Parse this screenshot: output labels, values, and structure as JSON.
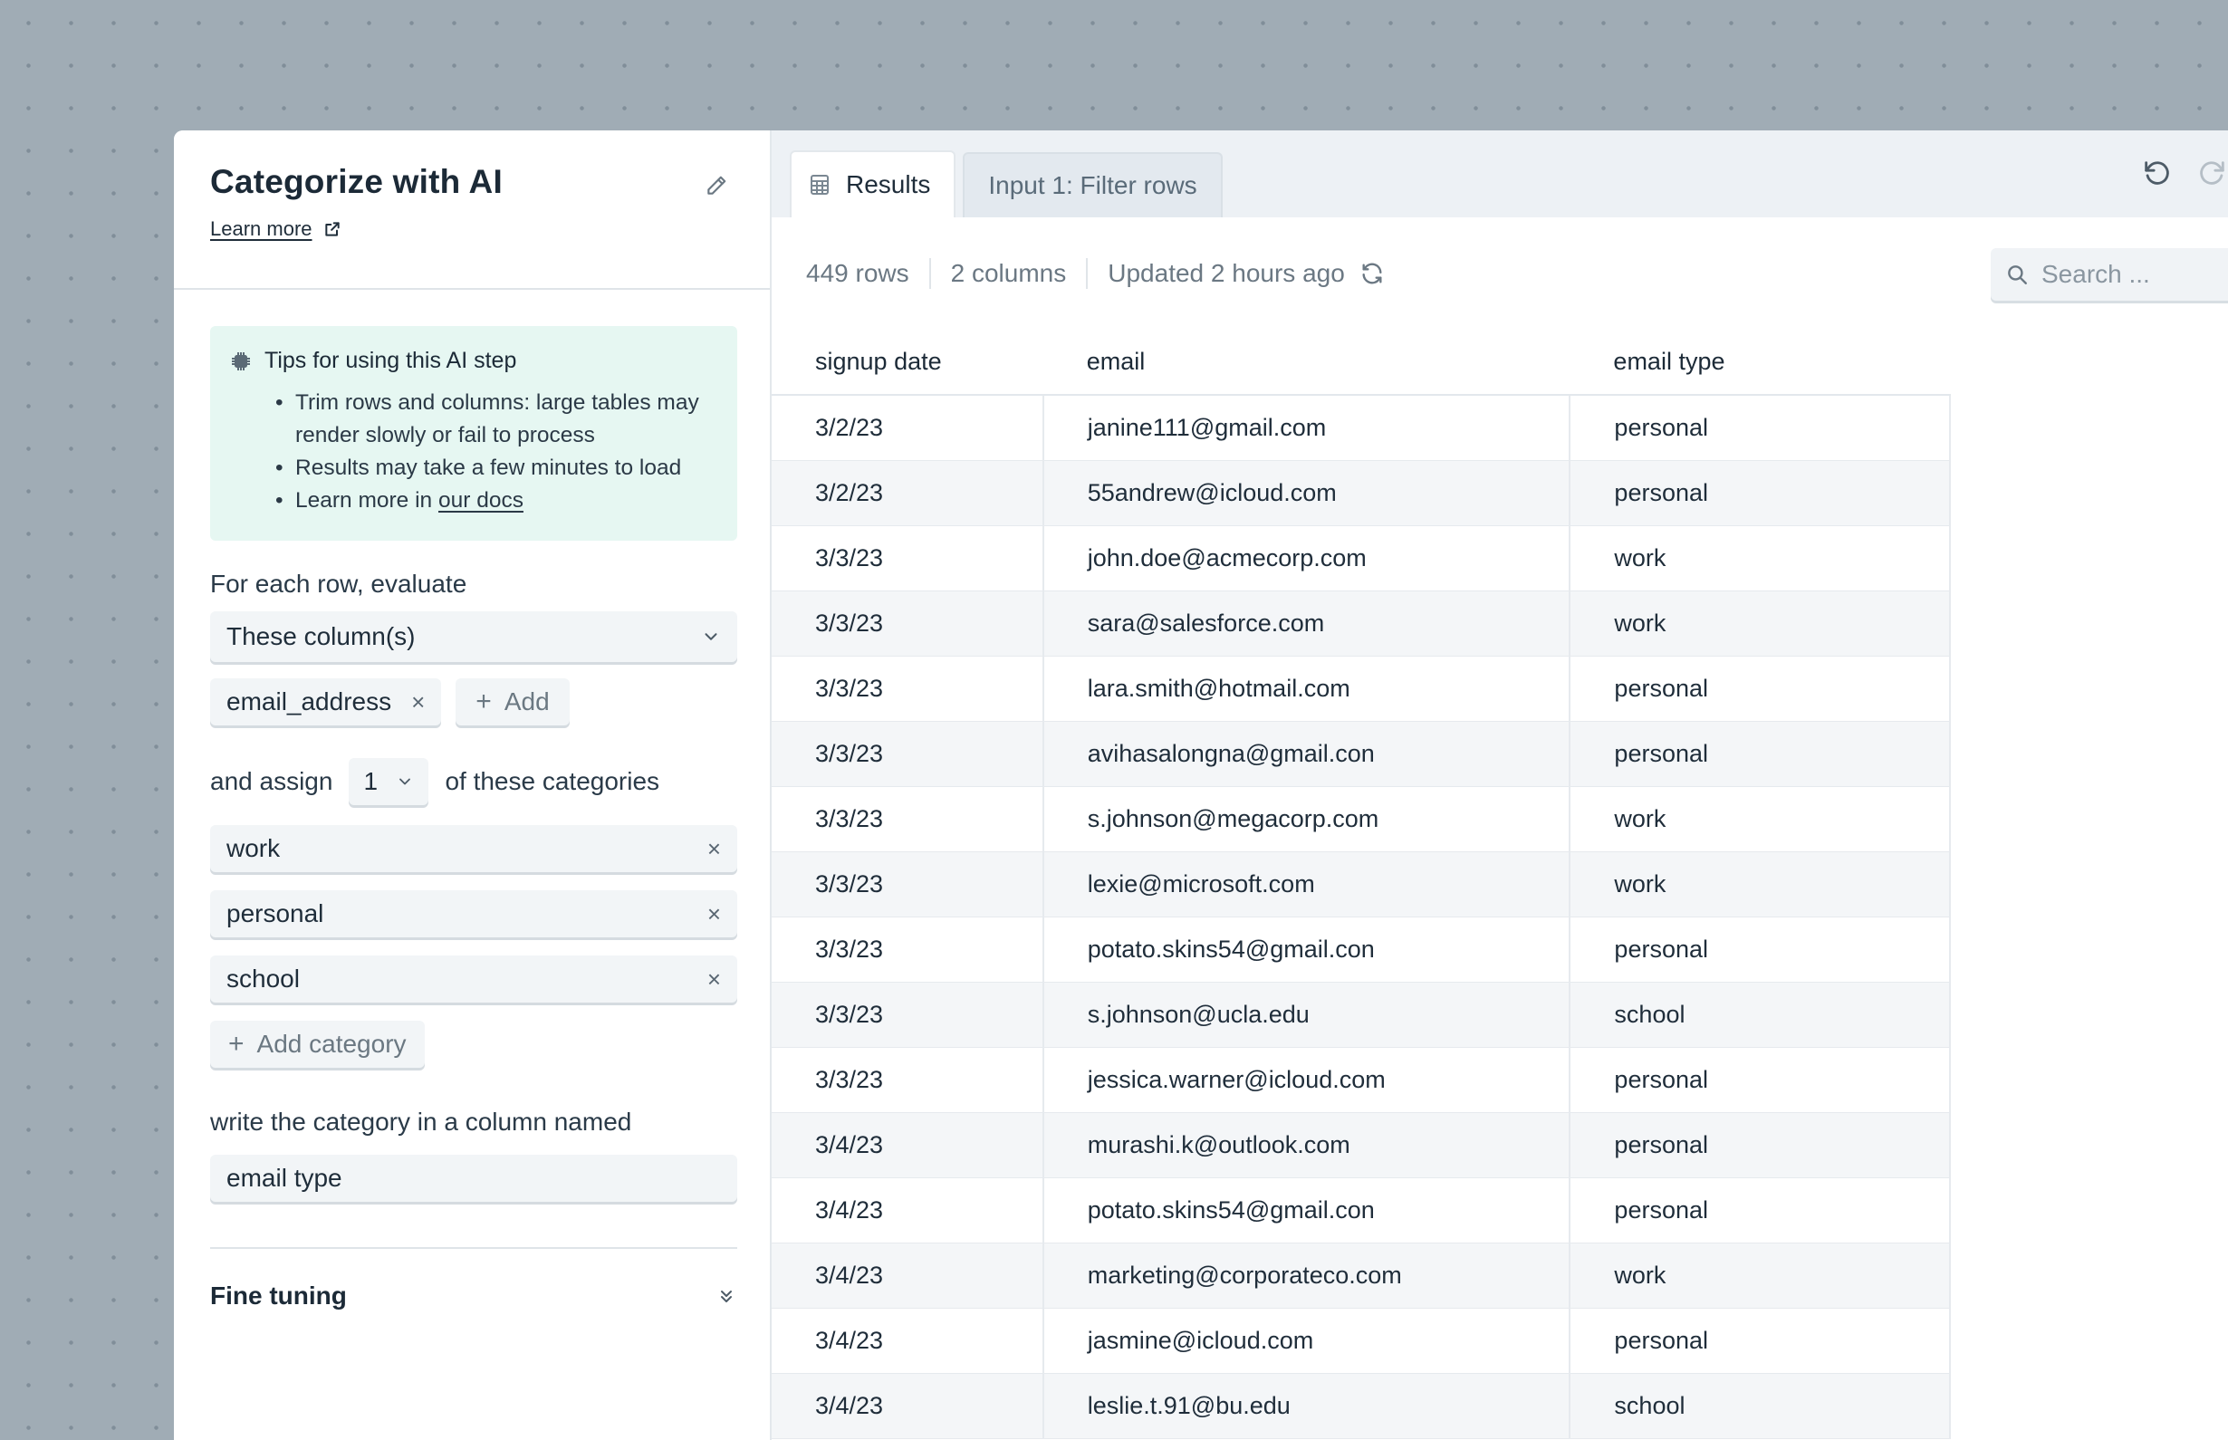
{
  "step": {
    "title": "Categorize with AI",
    "learn_more": "Learn more",
    "tips_title": "Tips for using this AI step",
    "tips": [
      "Trim rows and columns: large tables may render slowly or fail to process",
      "Results may take a few minutes to load"
    ],
    "tips_docs_prefix": "Learn more in ",
    "tips_docs_link": "our docs",
    "evaluate_label": "For each row, evaluate",
    "evaluate_select": "These column(s)",
    "columns": [
      "email_address"
    ],
    "add_label": "Add",
    "assign_prefix": "and assign",
    "assign_count": "1",
    "assign_suffix": "of these categories",
    "categories": [
      "work",
      "personal",
      "school"
    ],
    "add_category": "Add category",
    "column_name_label": "write the category in a column named",
    "column_name_value": "email type",
    "fine_tuning": "Fine tuning"
  },
  "tabs": {
    "results": "Results",
    "input1": "Input 1: Filter rows"
  },
  "meta": {
    "rows": "449 rows",
    "columns": "2 columns",
    "updated": "Updated 2 hours ago"
  },
  "search": {
    "placeholder": "Search ..."
  },
  "table": {
    "headers": [
      "signup date",
      "email",
      "email type"
    ],
    "rows": [
      [
        "3/2/23",
        "janine111@gmail.com",
        "personal"
      ],
      [
        "3/2/23",
        "55andrew@icloud.com",
        "personal"
      ],
      [
        "3/3/23",
        "john.doe@acmecorp.com",
        "work"
      ],
      [
        "3/3/23",
        "sara@salesforce.com",
        "work"
      ],
      [
        "3/3/23",
        "lara.smith@hotmail.com",
        "personal"
      ],
      [
        "3/3/23",
        "avihasalongna@gmail.con",
        "personal"
      ],
      [
        "3/3/23",
        "s.johnson@megacorp.com",
        "work"
      ],
      [
        "3/3/23",
        "lexie@microsoft.com",
        "work"
      ],
      [
        "3/3/23",
        "potato.skins54@gmail.con",
        "personal"
      ],
      [
        "3/3/23",
        "s.johnson@ucla.edu",
        "school"
      ],
      [
        "3/3/23",
        "jessica.warner@icloud.com",
        "personal"
      ],
      [
        "3/4/23",
        "murashi.k@outlook.com",
        "personal"
      ],
      [
        "3/4/23",
        "potato.skins54@gmail.con",
        "personal"
      ],
      [
        "3/4/23",
        "marketing@corporateco.com",
        "work"
      ],
      [
        "3/4/23",
        "jasmine@icloud.com",
        "personal"
      ],
      [
        "3/4/23",
        "leslie.t.91@bu.edu",
        "school"
      ]
    ]
  },
  "icons": {
    "edit": "pencil-icon",
    "external": "external-link-icon",
    "tips": "chip-icon",
    "table": "table-icon",
    "refresh": "refresh-icon",
    "undo": "undo-icon",
    "redo": "redo-icon",
    "search": "search-icon"
  },
  "colors": {
    "background": "#a0acb5",
    "tips_bg": "#e6f7f2",
    "input_bg": "#f2f5f7",
    "tab_bar": "#edf1f5"
  }
}
